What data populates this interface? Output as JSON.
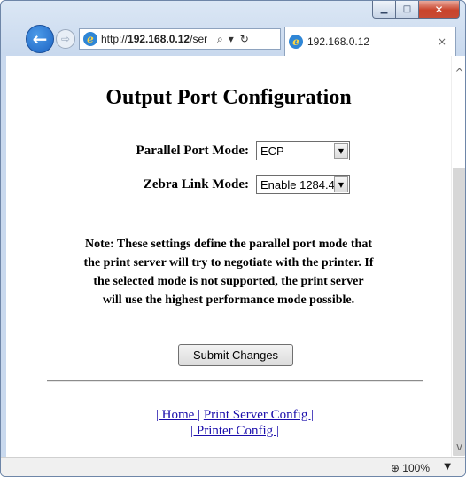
{
  "window": {
    "minimize_glyph": "▁",
    "maximize_glyph": "□",
    "close_glyph": "✕"
  },
  "nav": {
    "back_glyph": "←",
    "forward_glyph": "⇨",
    "url_prefix": "http://",
    "url_host": "192.168.0.12",
    "url_suffix": "/ser",
    "search_glyph": "⌕",
    "dropdown_glyph": "▾",
    "refresh_glyph": "↻"
  },
  "tab": {
    "title": "192.168.0.12",
    "close_glyph": "×"
  },
  "page": {
    "title": "Output Port Configuration",
    "parallel_label": "Parallel Port Mode:",
    "parallel_value": "ECP",
    "zebra_label": "Zebra Link Mode:",
    "zebra_value": "Enable 1284.4",
    "note_lines": [
      "Note: These settings define the parallel port mode that",
      "the print server will try to negotiate with the printer. If",
      "the selected mode is not supported, the print server",
      "will use the highest performance mode possible."
    ],
    "submit_label": "Submit Changes",
    "links": {
      "home": "| Home |",
      "print_server_config": "Print Server Config |",
      "printer_config": "| Printer Config |"
    }
  },
  "status": {
    "zoom": "100%",
    "zoom_glyph": "⊕",
    "zoom_arrow": "▼"
  },
  "scroll": {
    "up_glyph": "^",
    "down_glyph": "v"
  }
}
